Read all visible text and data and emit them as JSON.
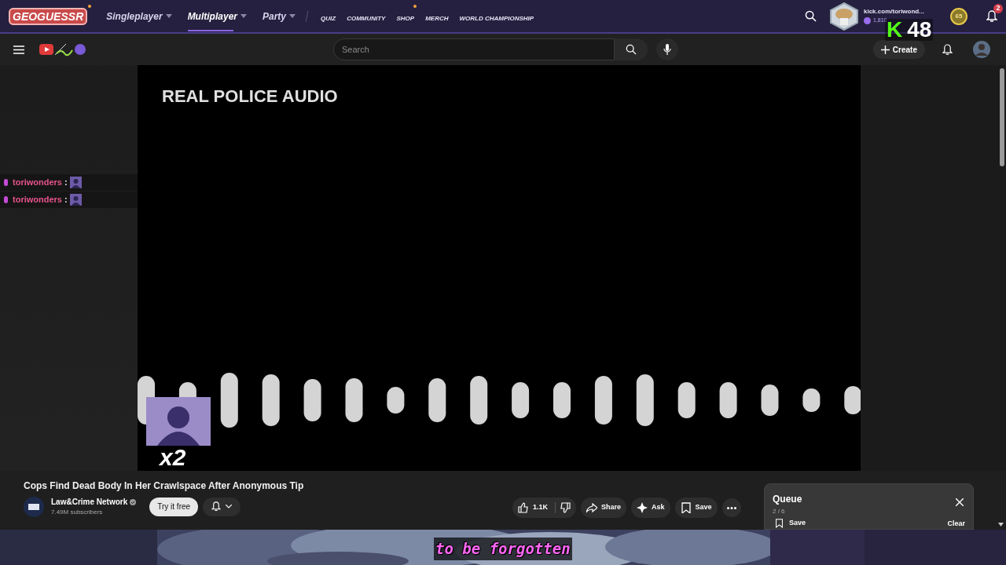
{
  "geoguessr_nav": {
    "logo": "GEOGUESSR",
    "items": [
      {
        "label": "Singleplayer",
        "selected": false
      },
      {
        "label": "Multiplayer",
        "selected": true
      },
      {
        "label": "Party",
        "selected": false
      }
    ],
    "links": [
      {
        "label": "QUIZ",
        "dot": false
      },
      {
        "label": "COMMUNITY",
        "dot": false
      },
      {
        "label": "SHOP",
        "dot": true
      },
      {
        "label": "MERCH",
        "dot": false
      },
      {
        "label": "WORLD CHAMPIONSHIP",
        "dot": false
      }
    ],
    "profile": {
      "name": "kick.com/toriwond...",
      "coins": "1,810"
    },
    "level": "65",
    "notifications": "2"
  },
  "kick_overlay": {
    "letter": "K",
    "count": "48"
  },
  "youtube_bar": {
    "search": {
      "placeholder": "Search"
    },
    "create": "Create"
  },
  "chat": [
    {
      "user": "toriwonders",
      "separator": ":"
    },
    {
      "user": "toriwonders",
      "separator": ":"
    }
  ],
  "video": {
    "heading": "REAL POLICE AUDIO",
    "emote_multiplier": "x2"
  },
  "title": "Cops Find Dead Body In Her Crawlspace After Anonymous Tip",
  "channel": {
    "name": "Law&Crime Network",
    "subscribers": "7.49M subscribers",
    "verified": true
  },
  "subscribe_button": "Try it free",
  "likes": "1.1K",
  "actions": [
    "Share",
    "Ask",
    "Save"
  ],
  "queue": {
    "title": "Queue",
    "position": "2 / 6",
    "save": "Save",
    "clear": "Clear"
  },
  "caption": "to be forgotten"
}
